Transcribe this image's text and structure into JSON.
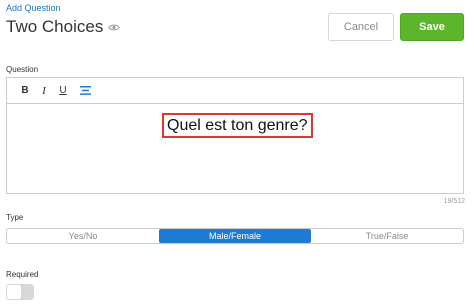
{
  "header": {
    "breadcrumb": "Add Question",
    "title": "Two Choices",
    "title_icon": "eye-icon"
  },
  "actions": {
    "cancel_label": "Cancel",
    "save_label": "Save",
    "save_color": "#5cb52a"
  },
  "question": {
    "label": "Question",
    "toolbar": {
      "bold": "B",
      "italic": "I",
      "underline": "U",
      "align_icon": "align-center-icon"
    },
    "text": "Quel est ton genre?",
    "char_count": "19/512"
  },
  "type": {
    "label": "Type",
    "options": [
      "Yes/No",
      "Male/Female",
      "True/False"
    ],
    "selected": "Male/Female",
    "accent_color": "#1f7ad6"
  },
  "required": {
    "label": "Required",
    "enabled": false
  }
}
